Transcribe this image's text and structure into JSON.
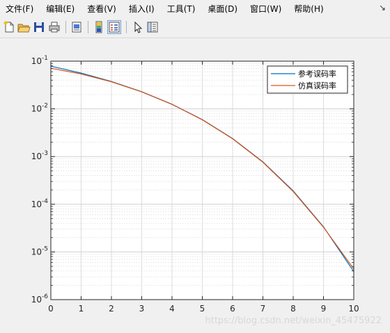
{
  "menubar": {
    "items": [
      {
        "label": "文件(F)"
      },
      {
        "label": "编辑(E)"
      },
      {
        "label": "查看(V)"
      },
      {
        "label": "插入(I)"
      },
      {
        "label": "工具(T)"
      },
      {
        "label": "桌面(D)"
      },
      {
        "label": "窗口(W)"
      },
      {
        "label": "帮助(H)"
      }
    ],
    "dock_icon": "dock-arrow-icon"
  },
  "toolbar": {
    "buttons": [
      "new-figure-icon",
      "open-file-icon",
      "save-icon",
      "print-icon",
      "print-preview-icon",
      "colorbar-icon",
      "legend-icon",
      "edit-plot-icon",
      "property-inspector-icon"
    ]
  },
  "chart_data": {
    "type": "line",
    "x": [
      0,
      1,
      2,
      3,
      4,
      5,
      6,
      7,
      8,
      9,
      10
    ],
    "xlim": [
      0,
      10
    ],
    "ylim": [
      1e-06,
      0.1
    ],
    "yscale": "log",
    "x_ticks": [
      "0",
      "1",
      "2",
      "3",
      "4",
      "5",
      "6",
      "7",
      "8",
      "9",
      "10"
    ],
    "y_ticks": [
      {
        "base": "10",
        "exp": "-6"
      },
      {
        "base": "10",
        "exp": "-5"
      },
      {
        "base": "10",
        "exp": "-4"
      },
      {
        "base": "10",
        "exp": "-3"
      },
      {
        "base": "10",
        "exp": "-2"
      },
      {
        "base": "10",
        "exp": "-1"
      }
    ],
    "grid": true,
    "minor_grid": true,
    "legend_position": "top-right",
    "series": [
      {
        "name": "参考误码率",
        "color": "#0072BD",
        "values": [
          0.0786,
          0.0563,
          0.0375,
          0.0229,
          0.0125,
          0.00595,
          0.00239,
          0.000773,
          0.000191,
          3.36e-05,
          3.87e-06
        ]
      },
      {
        "name": "仿真误码率",
        "color": "#D95319",
        "values": [
          0.071,
          0.054,
          0.037,
          0.0227,
          0.0124,
          0.0059,
          0.00236,
          0.00076,
          0.000185,
          3.3e-05,
          4.4e-06
        ]
      }
    ]
  },
  "watermark": "https://blog.csdn.net/weixin_45475922"
}
